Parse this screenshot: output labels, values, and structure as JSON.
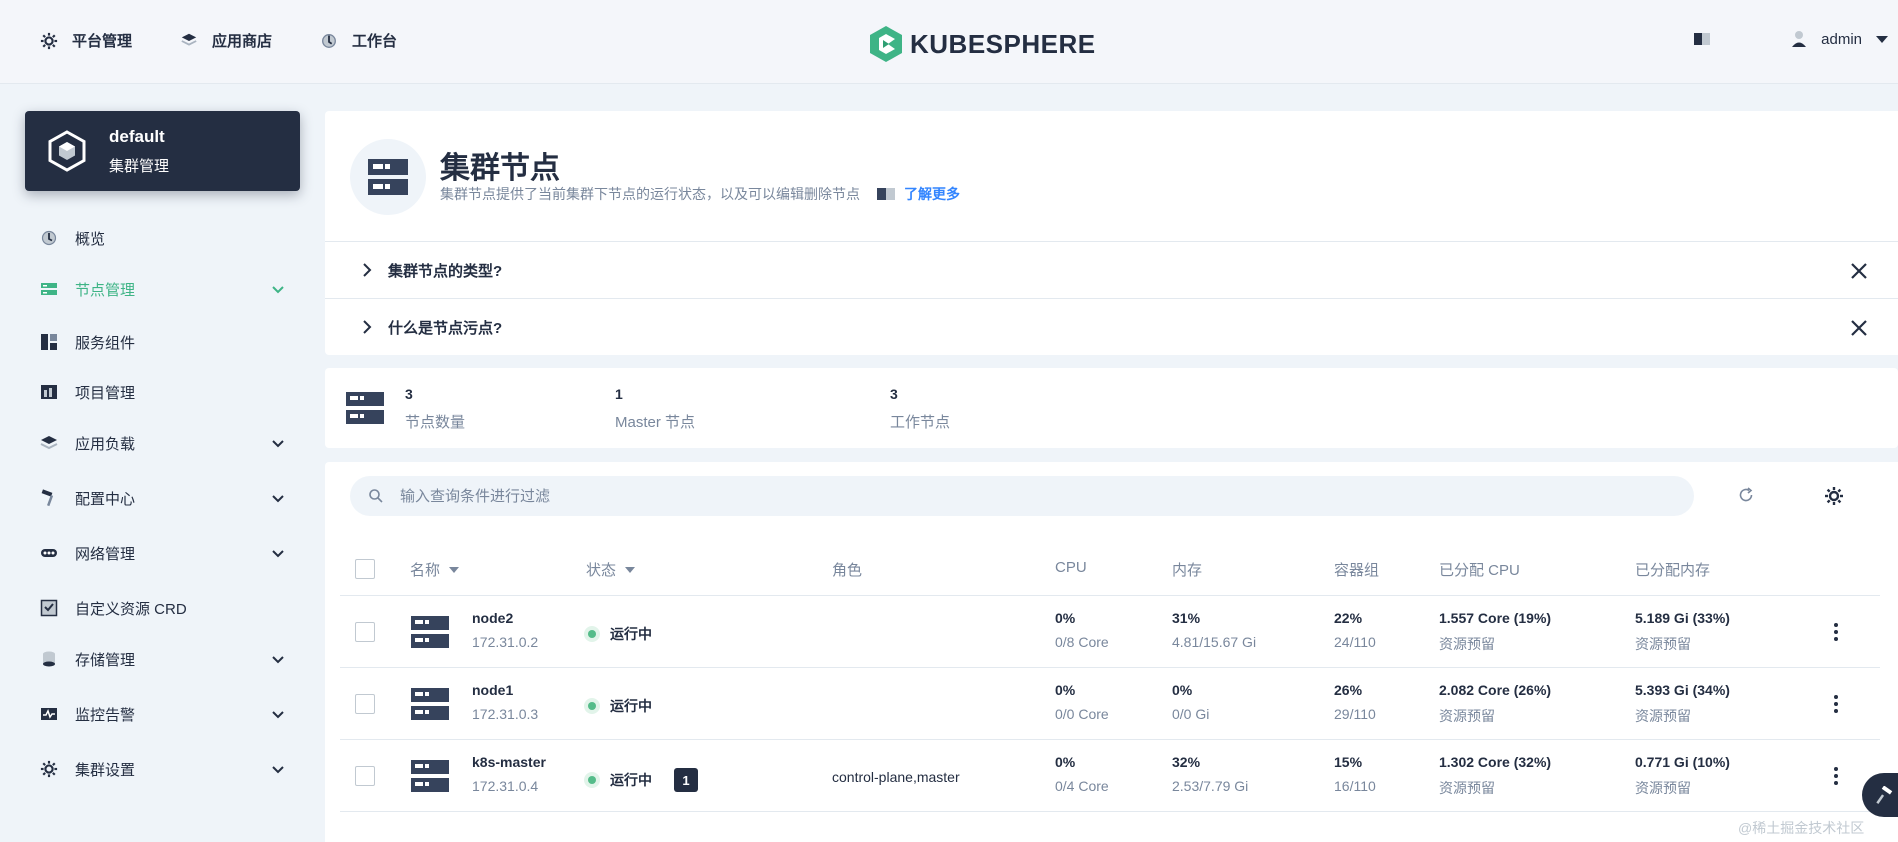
{
  "topnav": {
    "items": [
      {
        "label": "平台管理",
        "icon": "gear-icon"
      },
      {
        "label": "应用商店",
        "icon": "layers-icon"
      },
      {
        "label": "工作台",
        "icon": "dashboard-icon"
      }
    ],
    "logo": "KUBESPHERE",
    "user": "admin"
  },
  "cluster": {
    "name": "default",
    "subtitle": "集群管理"
  },
  "sidebar": {
    "items": [
      {
        "label": "概览",
        "icon": "dashboard-icon",
        "expandable": false
      },
      {
        "label": "节点管理",
        "icon": "node-icon",
        "expandable": true,
        "active": true
      },
      {
        "label": "服务组件",
        "icon": "components-icon",
        "expandable": false
      },
      {
        "label": "项目管理",
        "icon": "project-icon",
        "expandable": false
      },
      {
        "label": "应用负载",
        "icon": "layers-icon",
        "expandable": true
      },
      {
        "label": "配置中心",
        "icon": "hammer-icon",
        "expandable": true
      },
      {
        "label": "网络管理",
        "icon": "network-icon",
        "expandable": true
      },
      {
        "label": "自定义资源 CRD",
        "icon": "crd-icon",
        "expandable": false
      },
      {
        "label": "存储管理",
        "icon": "storage-icon",
        "expandable": true
      },
      {
        "label": "监控告警",
        "icon": "monitor-icon",
        "expandable": true
      },
      {
        "label": "集群设置",
        "icon": "gear-icon",
        "expandable": true
      }
    ]
  },
  "hero": {
    "title": "集群节点",
    "description": "集群节点提供了当前集群下节点的运行状态，以及可以编辑删除节点",
    "learn_more": "了解更多"
  },
  "faq": [
    {
      "label": "集群节点的类型?"
    },
    {
      "label": "什么是节点污点?"
    }
  ],
  "stats": [
    {
      "value": "3",
      "label": "节点数量"
    },
    {
      "value": "1",
      "label": "Master 节点"
    },
    {
      "value": "3",
      "label": "工作节点"
    }
  ],
  "search": {
    "placeholder": "输入查询条件进行过滤"
  },
  "table": {
    "headers": {
      "name": "名称",
      "status": "状态",
      "role": "角色",
      "cpu": "CPU",
      "memory": "内存",
      "pods": "容器组",
      "alloc_cpu": "已分配 CPU",
      "alloc_mem": "已分配内存"
    },
    "rows": [
      {
        "name": "node2",
        "ip": "172.31.0.2",
        "status": "运行中",
        "taints": "",
        "role": "",
        "cpu": "0%",
        "cpu_detail": "0/8 Core",
        "mem": "31%",
        "mem_detail": "4.81/15.67 Gi",
        "pods": "22%",
        "pods_detail": "24/110",
        "alloc_cpu": "1.557 Core (19%)",
        "alloc_cpu_detail": "资源预留",
        "alloc_mem": "5.189 Gi (33%)",
        "alloc_mem_detail": "资源预留"
      },
      {
        "name": "node1",
        "ip": "172.31.0.3",
        "status": "运行中",
        "taints": "",
        "role": "",
        "cpu": "0%",
        "cpu_detail": "0/0 Core",
        "mem": "0%",
        "mem_detail": "0/0 Gi",
        "pods": "26%",
        "pods_detail": "29/110",
        "alloc_cpu": "2.082 Core (26%)",
        "alloc_cpu_detail": "资源预留",
        "alloc_mem": "5.393 Gi (34%)",
        "alloc_mem_detail": "资源预留"
      },
      {
        "name": "k8s-master",
        "ip": "172.31.0.4",
        "status": "运行中",
        "taints": "1",
        "role": "control-plane,master",
        "cpu": "0%",
        "cpu_detail": "0/4 Core",
        "mem": "32%",
        "mem_detail": "2.53/7.79 Gi",
        "pods": "15%",
        "pods_detail": "16/110",
        "alloc_cpu": "1.302 Core (32%)",
        "alloc_cpu_detail": "资源预留",
        "alloc_mem": "0.771 Gi (10%)",
        "alloc_mem_detail": "资源预留"
      }
    ]
  },
  "watermark": "@稀土掘金技术社区",
  "colors": {
    "accent": "#3eb486",
    "dark": "#242e42",
    "muted": "#79879c",
    "link": "#3385ff",
    "running": "#55bc8a"
  }
}
